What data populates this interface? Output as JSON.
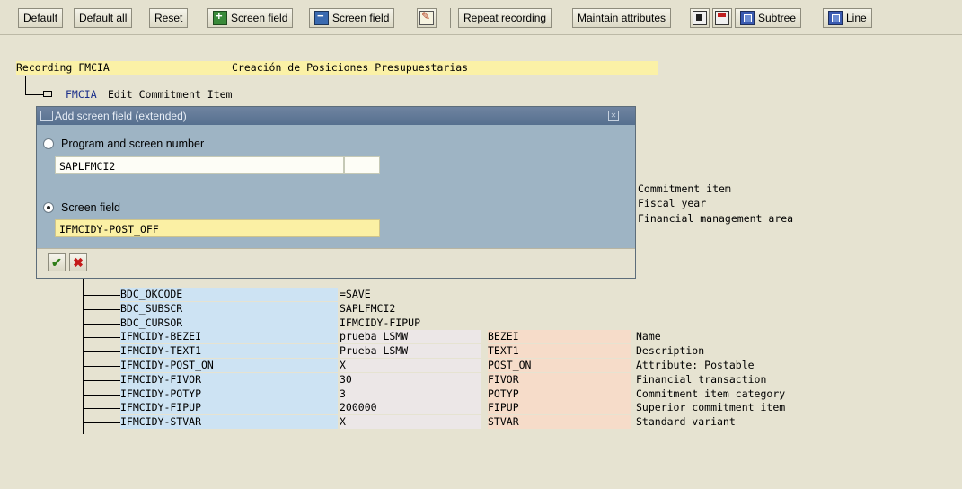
{
  "toolbar": {
    "default": "Default",
    "default_all": "Default all",
    "reset": "Reset",
    "screen_field_add": "Screen field",
    "screen_field_delete": "Screen field",
    "repeat_recording": "Repeat recording",
    "maintain_attributes": "Maintain attributes",
    "subtree": "Subtree",
    "line": "Line"
  },
  "recording": {
    "name": "Recording FMCIA",
    "description": "Creación de Posiciones Presupuestarias"
  },
  "transaction": {
    "code": "FMCIA",
    "text": "Edit Commitment Item"
  },
  "side_fields": [
    "Commitment item",
    "Fiscal year",
    "Financial management area"
  ],
  "dialog": {
    "title": "Add screen field (extended)",
    "program_label": "Program and screen number",
    "program_value": "SAPLFMCI2",
    "program_number": "",
    "screen_field_label": "Screen field",
    "screen_field_value": "IFMCIDY-POST_OFF"
  },
  "rows": [
    {
      "field": "BDC_OKCODE",
      "value": "=SAVE",
      "name": "",
      "description": ""
    },
    {
      "field": "BDC_SUBSCR",
      "value": "SAPLFMCI2",
      "name": "",
      "description": ""
    },
    {
      "field": "BDC_CURSOR",
      "value": "IFMCIDY-FIPUP",
      "name": "",
      "description": ""
    },
    {
      "field": "IFMCIDY-BEZEI",
      "value": "prueba LSMW",
      "name": "BEZEI",
      "description": "Name"
    },
    {
      "field": "IFMCIDY-TEXT1",
      "value": "Prueba LSMW",
      "name": "TEXT1",
      "description": "Description"
    },
    {
      "field": "IFMCIDY-POST_ON",
      "value": "X",
      "name": "POST_ON",
      "description": "Attribute: Postable"
    },
    {
      "field": "IFMCIDY-FIVOR",
      "value": "30",
      "name": "FIVOR",
      "description": "Financial transaction"
    },
    {
      "field": "IFMCIDY-POTYP",
      "value": "3",
      "name": "POTYP",
      "description": "Commitment item category"
    },
    {
      "field": "IFMCIDY-FIPUP",
      "value": "200000",
      "name": "FIPUP",
      "description": "Superior commitment item"
    },
    {
      "field": "IFMCIDY-STVAR",
      "value": "X",
      "name": "STVAR",
      "description": "Standard variant"
    }
  ],
  "icons": {
    "add_field": "screen-field-add-icon",
    "delete_field": "screen-field-delete-icon",
    "edit": "edit-icon",
    "confirm": "checkmark-icon",
    "cancel": "cancel-icon"
  },
  "colors": {
    "background": "#e6e3d1",
    "highlight_yellow": "#fbf1a6",
    "field_blue": "#cde3f3",
    "name_peach": "#f6dcc9",
    "dialog_body": "#9eb4c4",
    "dialog_title": "#56708f"
  }
}
